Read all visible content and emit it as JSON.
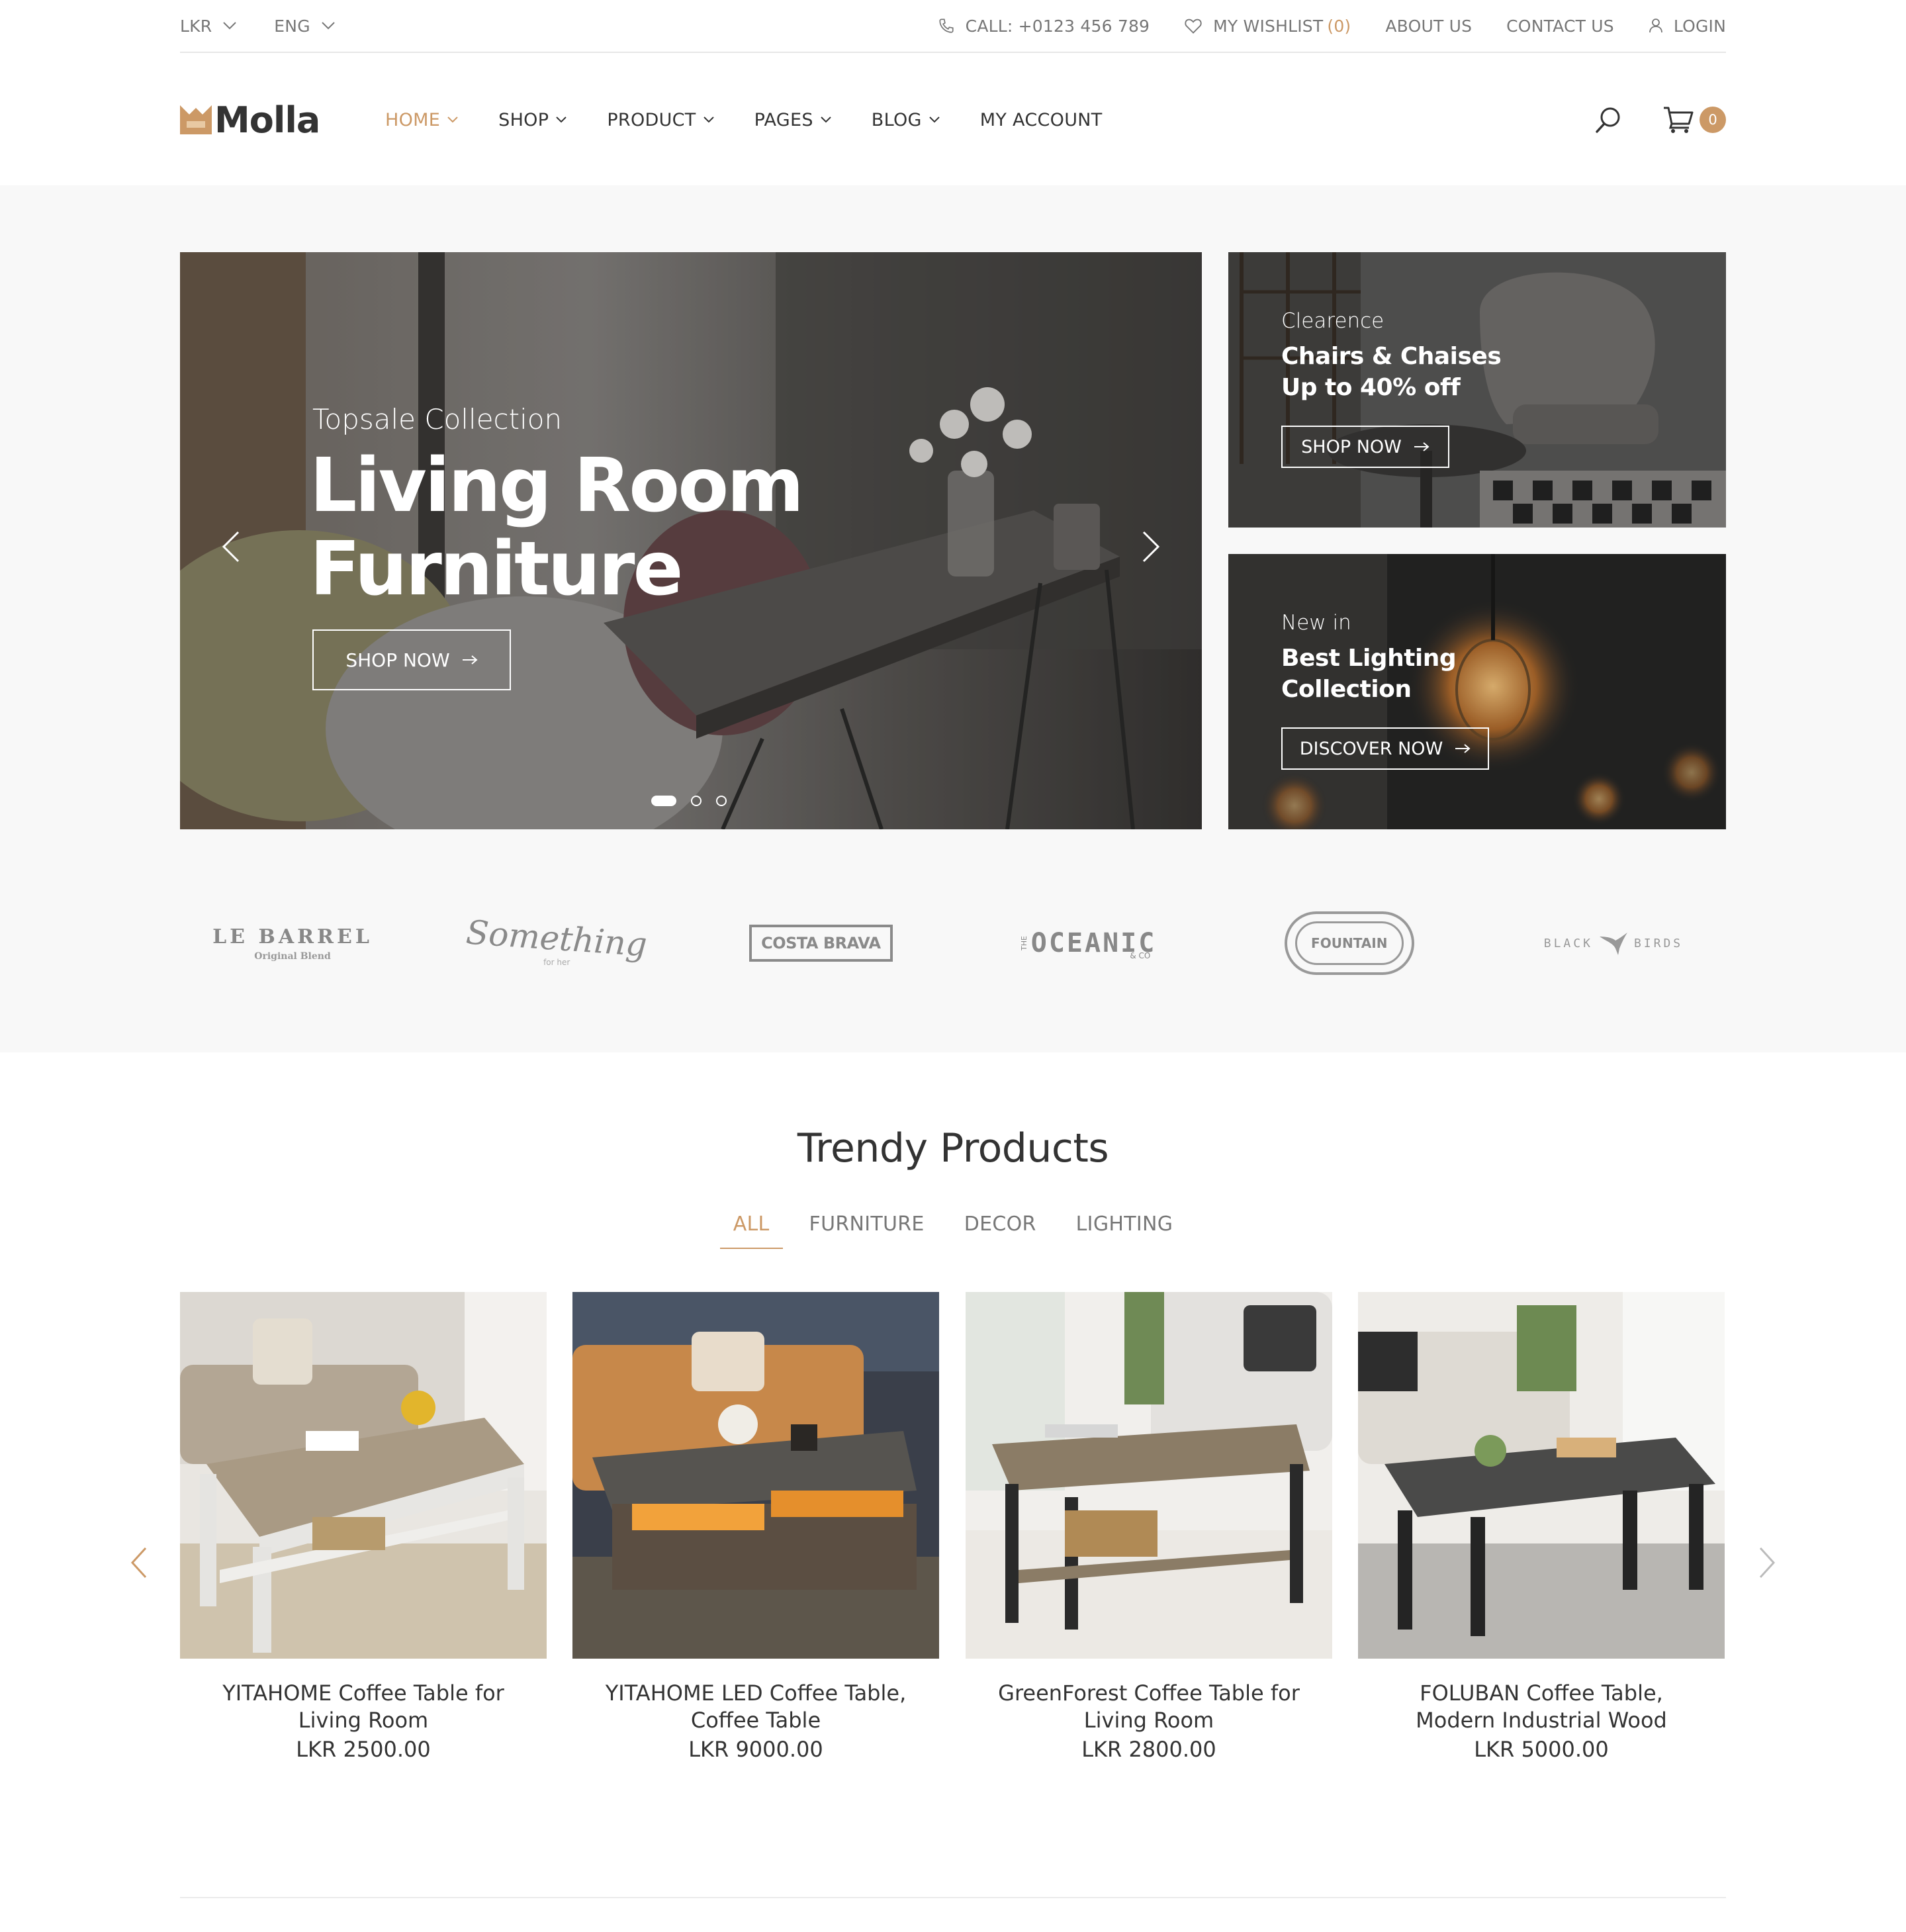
{
  "topbar": {
    "currency": "LKR",
    "language": "ENG",
    "call": "CALL: +0123 456 789",
    "wishlist_label": "MY WISHLIST",
    "wishlist_count": "(0)",
    "about": "ABOUT US",
    "contact": "CONTACT US",
    "login": "LOGIN"
  },
  "header": {
    "logo_text": "Molla",
    "nav": [
      {
        "label": "HOME",
        "active": true,
        "has_dropdown": true
      },
      {
        "label": "SHOP",
        "has_dropdown": true
      },
      {
        "label": "PRODUCT",
        "has_dropdown": true
      },
      {
        "label": "PAGES",
        "has_dropdown": true
      },
      {
        "label": "BLOG",
        "has_dropdown": true
      },
      {
        "label": "MY ACCOUNT",
        "has_dropdown": false
      }
    ],
    "cart_count": "0",
    "icons": [
      "search-icon",
      "cart-icon"
    ]
  },
  "hero": {
    "subtitle": "Topsale Collection",
    "title_line1": "Living Room",
    "title_line2": "Furniture",
    "button": "SHOP NOW",
    "slides_total": 3,
    "active_slide": 1
  },
  "banners": [
    {
      "sub": "Clearence",
      "title_line1": "Chairs & Chaises",
      "title_line2": "Up to 40% off",
      "button": "SHOP NOW"
    },
    {
      "sub": "New in",
      "title_line1": "Best Lighting",
      "title_line2": "Collection",
      "button": "DISCOVER NOW"
    }
  ],
  "brands": [
    {
      "name": "LE BARREL",
      "tagline": "Original Blend"
    },
    {
      "name": "Something",
      "tagline": "for her"
    },
    {
      "name": "COSTA BRAVA"
    },
    {
      "name": "OCEANIC",
      "prefix": "THE",
      "suffix": "& CO"
    },
    {
      "name": "FOUNTAIN"
    },
    {
      "name": "BLACK BIRDS",
      "left": "BLACK",
      "right": "BIRDS"
    }
  ],
  "trendy": {
    "title": "Trendy Products",
    "tabs": [
      "ALL",
      "FURNITURE",
      "DECOR",
      "LIGHTING"
    ],
    "active_tab": "ALL",
    "products": [
      {
        "name": "YITAHOME Coffee Table for Living Room",
        "price": "LKR 2500.00"
      },
      {
        "name": "YITAHOME LED Coffee Table, Coffee Table",
        "price": "LKR 9000.00"
      },
      {
        "name": "GreenForest Coffee Table for Living Room",
        "price": "LKR 2800.00"
      },
      {
        "name": "FOLUBAN Coffee Table, Modern Industrial Wood",
        "price": "LKR 5000.00"
      }
    ]
  },
  "colors": {
    "accent": "#cc9966",
    "text": "#333333",
    "muted": "#777777",
    "band": "#f8f8f8"
  }
}
